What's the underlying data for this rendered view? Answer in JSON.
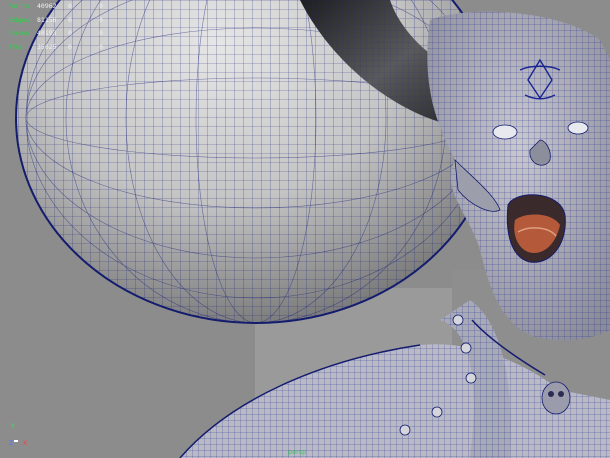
{
  "hud": {
    "rows": [
      {
        "label": "Verts:",
        "v1": "40962",
        "v2": "0",
        "v3": "0"
      },
      {
        "label": "Edges:",
        "v1": "81156",
        "v2": "0",
        "v3": "0"
      },
      {
        "label": "Faces:",
        "v1": "40193",
        "v2": "0",
        "v3": "0"
      },
      {
        "label": "UVs:",
        "v1": "35025",
        "v2": "0",
        "v3": "0"
      }
    ]
  },
  "axis": {
    "y": "Y",
    "z": "Z",
    "x": "X"
  },
  "camera_label": "persp",
  "colors": {
    "viewport_bg": "#8c8c8c",
    "wire": "#1a237a",
    "hud_label": "#2bd44a"
  }
}
